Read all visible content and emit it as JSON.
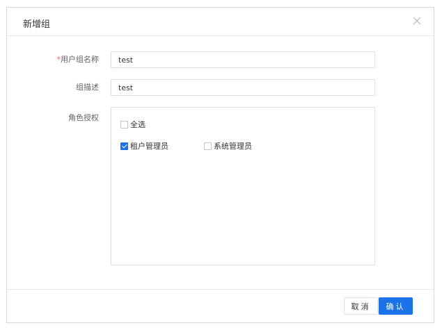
{
  "dialog": {
    "title": "新增组",
    "close_icon": "close-icon"
  },
  "form": {
    "group_name": {
      "required_mark": "*",
      "label": "用户组名称",
      "value": "test"
    },
    "group_desc": {
      "label": "组描述",
      "value": "test"
    },
    "role_auth": {
      "label": "角色授权",
      "select_all": {
        "label": "全选",
        "checked": false
      },
      "roles": [
        {
          "label": "租户管理员",
          "checked": true
        },
        {
          "label": "系统管理员",
          "checked": false
        }
      ]
    }
  },
  "footer": {
    "cancel_label": "取消",
    "confirm_label": "确认"
  },
  "colors": {
    "primary": "#1a73e8",
    "required": "#f56c6c",
    "border": "#dcdfe6"
  }
}
